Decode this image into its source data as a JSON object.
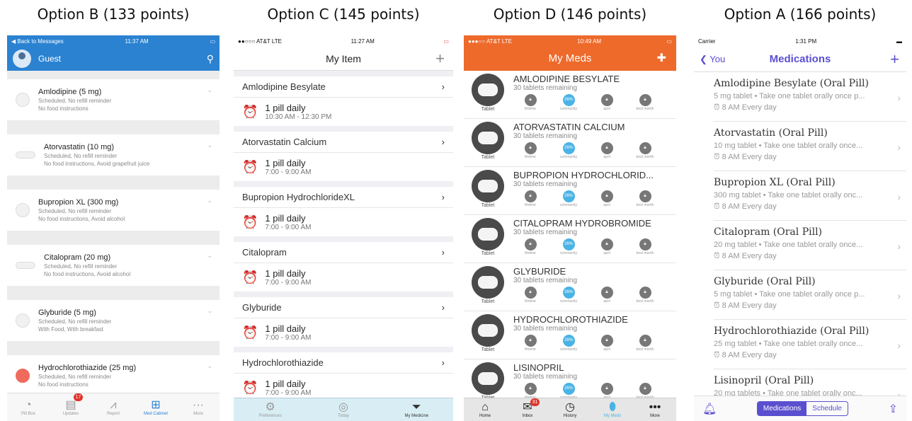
{
  "titles": {
    "b": "Option B (133 points)",
    "c": "Option C (145 points)",
    "d": "Option D (146 points)",
    "a": "Option A (166 points)"
  },
  "option_b": {
    "status_back": "◀ Back to Messages",
    "status_time": "11:37 AM",
    "user": "Guest",
    "items": [
      {
        "name": "Amlodipine (5 mg)",
        "line1": "Scheduled, No refill reminder",
        "line2": "No food instructions",
        "pill": "round"
      },
      {
        "name": "Atorvastatin (10 mg)",
        "line1": "Scheduled, No refill reminder",
        "line2": "No food instructions, Avoid grapefruit juice",
        "pill": "oval"
      },
      {
        "name": "Bupropion XL (300 mg)",
        "line1": "Scheduled, No refill reminder",
        "line2": "No food instructions, Avoid alcohol",
        "pill": "round"
      },
      {
        "name": "Citalopram (20 mg)",
        "line1": "Scheduled, No refill reminder",
        "line2": "No food instructions, Avoid alcohol",
        "pill": "oval"
      },
      {
        "name": "Glyburide (5 mg)",
        "line1": "Scheduled, No refill reminder",
        "line2": "With Food, With breakfast",
        "pill": "round"
      },
      {
        "name": "Hydrochlorothiazide (25 mg)",
        "line1": "Scheduled, No refill reminder",
        "line2": "No food instructions",
        "pill": "red"
      }
    ],
    "tabs": [
      "Pill Box",
      "Updates",
      "Report",
      "Med Cabinet",
      "More"
    ],
    "updates_badge": "17"
  },
  "option_c": {
    "carrier": "●●○○○ AT&T  LTE",
    "time": "11:27 AM",
    "header": "My Item",
    "items": [
      {
        "name": "Amlodipine Besylate",
        "dose": "1 pill daily",
        "time": "10:30 AM - 12:30 PM"
      },
      {
        "name": "Atorvastatin Calcium",
        "dose": "1 pill daily",
        "time": "7:00 - 9:00 AM"
      },
      {
        "name": "Bupropion HydrochlorideXL",
        "dose": "1 pill daily",
        "time": "7:00 - 9:00 AM"
      },
      {
        "name": "Citalopram",
        "dose": "1 pill daily",
        "time": "7:00 - 9:00 AM"
      },
      {
        "name": "Glyburide",
        "dose": "1 pill daily",
        "time": "7:00 - 9:00 AM"
      },
      {
        "name": "Hydrochlorothiazide",
        "dose": "1 pill daily",
        "time": "7:00 - 9:00 AM"
      }
    ],
    "tabs": [
      "Preferences",
      "Today",
      "My Medicine"
    ]
  },
  "option_d": {
    "carrier": "●●●○○ AT&T  LTE",
    "time": "10:49 AM",
    "header": "My Meds",
    "tablet_label": "Tablet",
    "remaining": "30 tablets remaining",
    "stat_labels": [
      "lifetime",
      "community",
      "april",
      "best month"
    ],
    "community_pct": "26%",
    "meds": [
      "AMLODIPINE BESYLATE",
      "ATORVASTATIN CALCIUM",
      "BUPROPION HYDROCHLORID...",
      "CITALOPRAM HYDROBROMIDE",
      "GLYBURIDE",
      "HYDROCHLOROTHIAZIDE",
      "LISINOPRIL"
    ],
    "tabs": [
      "Home",
      "Inbox",
      "History",
      "My Meds",
      "More"
    ],
    "inbox_badge": "31"
  },
  "option_a": {
    "carrier": "Carrier",
    "time": "1:31 PM",
    "back": "You",
    "title": "Medications",
    "items": [
      {
        "name": "Amlodipine Besylate (Oral Pill)",
        "detail": "5 mg tablet • Take one tablet orally once p...",
        "sched": "8 AM Every day"
      },
      {
        "name": "Atorvastatin (Oral Pill)",
        "detail": "10 mg tablet • Take one tablet orally once...",
        "sched": "8 AM Every day"
      },
      {
        "name": "Bupropion XL (Oral Pill)",
        "detail": "300 mg tablet • Take one tablet orally onc...",
        "sched": "8 AM Every day"
      },
      {
        "name": "Citalopram (Oral Pill)",
        "detail": "20 mg tablet • Take one tablet orally once...",
        "sched": "8 AM Every day"
      },
      {
        "name": "Glyburide (Oral Pill)",
        "detail": "5 mg tablet • Take one tablet orally once p...",
        "sched": "8 AM Every day"
      },
      {
        "name": "Hydrochlorothiazide (Oral Pill)",
        "detail": "25 mg tablet • Take one tablet orally once...",
        "sched": "8 AM Every day"
      },
      {
        "name": "Lisinopril (Oral Pill)",
        "detail": "20 mg tablets • Take one tablet orally onc...",
        "sched": ""
      }
    ],
    "seg_on": "Medications",
    "seg_off": "Schedule"
  }
}
